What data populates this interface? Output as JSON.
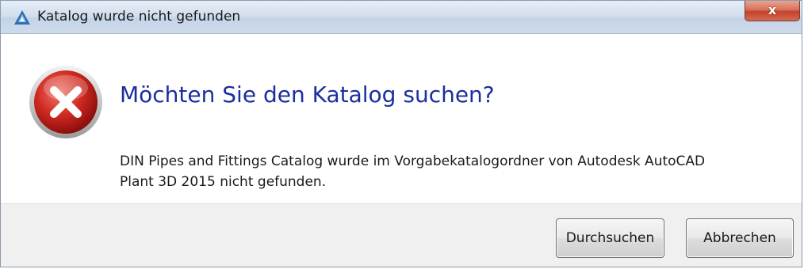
{
  "window": {
    "title": "Katalog wurde nicht gefunden",
    "close_label": "x"
  },
  "dialog": {
    "icon": "error-icon",
    "heading": "Möchten Sie den Katalog suchen?",
    "message_line1": "DIN Pipes and Fittings Catalog wurde im Vorgabekatalogordner von Autodesk AutoCAD",
    "message_line2": "Plant 3D 2015 nicht gefunden."
  },
  "buttons": {
    "browse_label": "Durchsuchen",
    "cancel_label": "Abbrechen"
  },
  "colors": {
    "heading": "#1b2f9e",
    "error_red": "#c8201c",
    "close_button": "#c4432c",
    "app_icon": "#2f6fb5"
  }
}
